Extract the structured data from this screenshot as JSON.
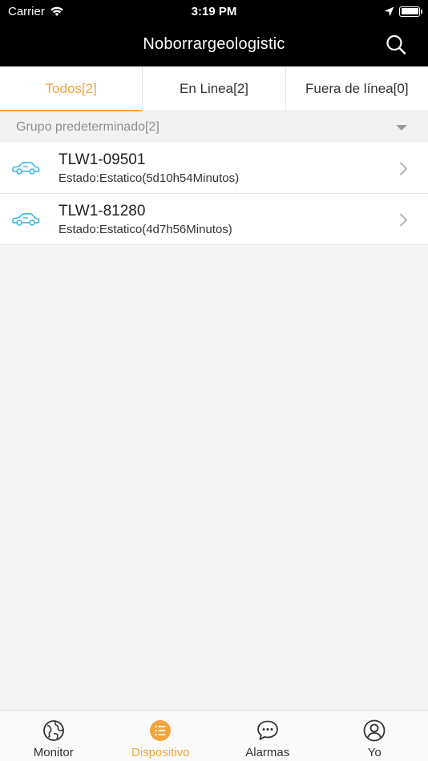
{
  "status_bar": {
    "carrier": "Carrier",
    "time": "3:19 PM"
  },
  "nav": {
    "title": "Noborrargeologistic"
  },
  "tabs": [
    {
      "label": "Todos[2]",
      "active": true
    },
    {
      "label": "En Linea[2]",
      "active": false
    },
    {
      "label": "Fuera de línea[0]",
      "active": false
    }
  ],
  "group": {
    "label": "Grupo predeterminado[2]"
  },
  "devices": [
    {
      "name": "TLW1-09501",
      "status": "Estado:Estatico(5d10h54Minutos)"
    },
    {
      "name": "TLW1-81280",
      "status": "Estado:Estatico(4d7h56Minutos)"
    }
  ],
  "tabbar": [
    {
      "label": "Monitor",
      "icon": "globe-icon",
      "active": false
    },
    {
      "label": "Dispositivo",
      "icon": "list-icon",
      "active": true
    },
    {
      "label": "Alarmas",
      "icon": "chat-bubble-icon",
      "active": false
    },
    {
      "label": "Yo",
      "icon": "person-icon",
      "active": false
    }
  ],
  "colors": {
    "accent": "#f5a33c",
    "car_icon": "#3bb8e6",
    "navbar": "#000000"
  }
}
